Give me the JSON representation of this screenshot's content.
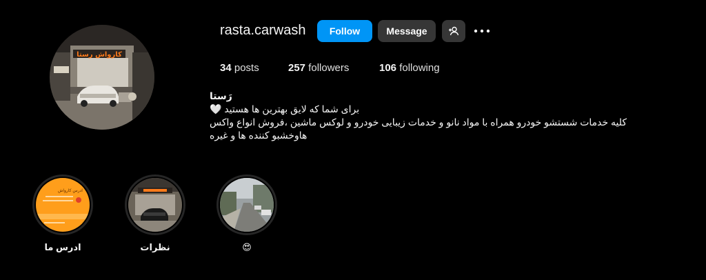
{
  "profile": {
    "username": "rasta.carwash",
    "follow_label": "Follow",
    "message_label": "Message",
    "suggest_icon": "person-add-icon",
    "options_icon": "more-horizontal-icon"
  },
  "stats": {
    "posts_count": "34",
    "posts_label": "posts",
    "followers_count": "257",
    "followers_label": "followers",
    "following_count": "106",
    "following_label": "following"
  },
  "bio": {
    "name": "رَستا",
    "line1": "برای شما که لایق بهترین ها هستید 🤍",
    "line2": "کلیه خدمات شستشو خودرو همراه با مواد نانو و خدمات زیبایی خودرو و لوکس ماشین ،فروش انواع واکس",
    "line3": "هاوخشبو کننده ها و غیره"
  },
  "avatar_sign_text": "کارواش رستا",
  "highlights": [
    {
      "label": "ادرس ما",
      "cover_text": "ادرس کارواش"
    },
    {
      "label": "نظرات"
    },
    {
      "label": "😍"
    }
  ],
  "colors": {
    "background": "#000000",
    "follow_button": "#0095f6",
    "secondary_button": "#363636",
    "sign_orange": "#ff7a1a",
    "address_card": "#ff9e1b"
  }
}
